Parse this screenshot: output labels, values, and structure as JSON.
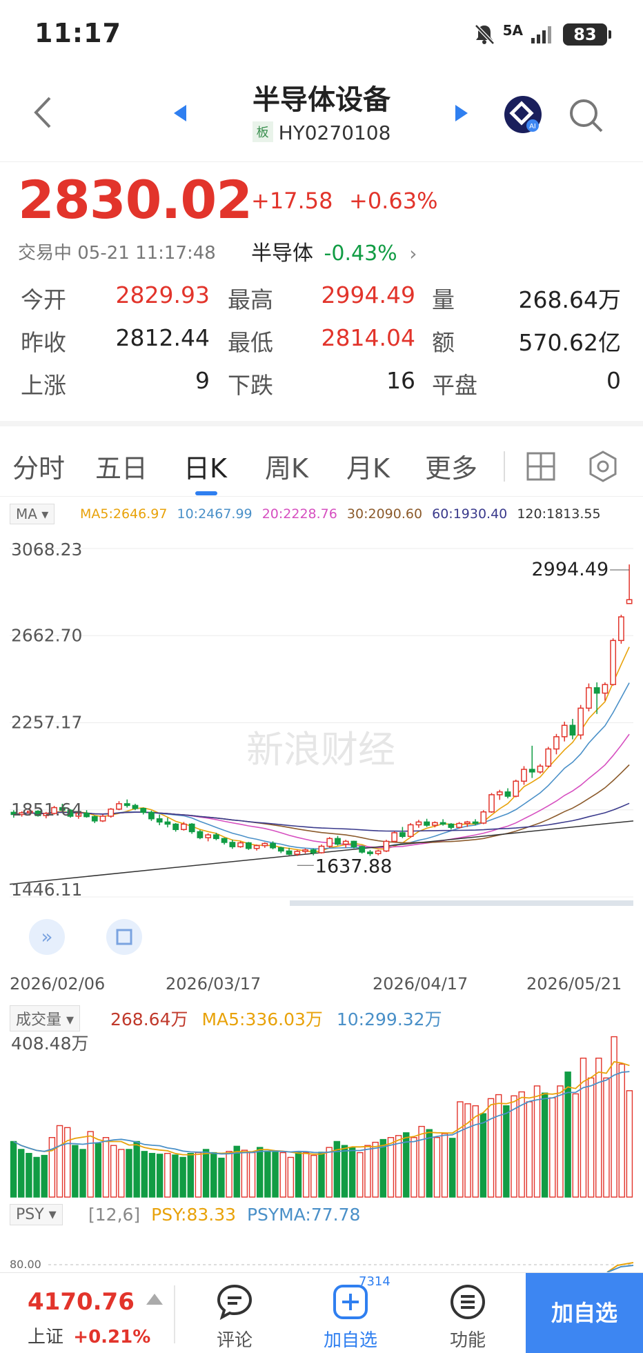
{
  "status_bar": {
    "time": "11:17",
    "network": "5A",
    "battery": "83"
  },
  "nav": {
    "title": "半导体设备",
    "tag": "板",
    "code": "HY0270108"
  },
  "quote": {
    "price": "2830.02",
    "change": "+17.58",
    "change_pct": "+0.63%",
    "trading_status": "交易中 05-21 11:17:48",
    "sector_label": "半导体",
    "sector_pct": "-0.43%"
  },
  "stats": {
    "open_label": "今开",
    "open": "2829.93",
    "high_label": "最高",
    "high": "2994.49",
    "volume_label": "量",
    "volume": "268.64万",
    "prev_close_label": "昨收",
    "prev_close": "2812.44",
    "low_label": "最低",
    "low": "2814.04",
    "amount_label": "额",
    "amount": "570.62亿",
    "up_label": "上涨",
    "up": "9",
    "down_label": "下跌",
    "down": "16",
    "flat_label": "平盘",
    "flat": "0"
  },
  "tabs": [
    "分时",
    "五日",
    "日K",
    "周K",
    "月K",
    "更多"
  ],
  "active_tab": "日K",
  "ma_legend": {
    "select": "MA ▾",
    "ma5": "MA5:2646.97",
    "ma10": "10:2467.99",
    "ma20": "20:2228.76",
    "ma30": "30:2090.60",
    "ma60": "60:1930.40",
    "ma120": "120:1813.55"
  },
  "colors": {
    "up": "#e2342b",
    "down": "#119c44",
    "ma5": "#e8a20a",
    "ma10": "#4a90c8",
    "ma20": "#d64fc0",
    "ma30": "#8b5a2b",
    "ma60": "#3a3a8c",
    "ma120": "#333333",
    "accent": "#2f7ff0"
  },
  "chart_data": [
    {
      "type": "candlestick",
      "title": "",
      "y_tick_labels": [
        "3068.23",
        "2662.70",
        "2257.17",
        "1851.64",
        "1446.11"
      ],
      "ylim": [
        1446.11,
        3068.23
      ],
      "x_tick_labels": [
        "2026/02/06",
        "2026/03/17",
        "2026/04/17",
        "2026/05/21"
      ],
      "annotations": [
        {
          "label": "2994.49",
          "value": 2994.49
        },
        {
          "label": "1637.88",
          "value": 1637.88
        }
      ],
      "watermark": "新浪财经",
      "series_note": "approx daily OHLC estimated from chart",
      "ohlc": [
        [
          1840,
          1850,
          1815,
          1830
        ],
        [
          1830,
          1845,
          1820,
          1838
        ],
        [
          1838,
          1860,
          1825,
          1845
        ],
        [
          1845,
          1850,
          1820,
          1825
        ],
        [
          1825,
          1842,
          1812,
          1835
        ],
        [
          1835,
          1870,
          1830,
          1862
        ],
        [
          1862,
          1880,
          1845,
          1850
        ],
        [
          1850,
          1855,
          1815,
          1822
        ],
        [
          1822,
          1840,
          1810,
          1836
        ],
        [
          1836,
          1850,
          1815,
          1820
        ],
        [
          1820,
          1825,
          1790,
          1800
        ],
        [
          1800,
          1830,
          1795,
          1822
        ],
        [
          1822,
          1860,
          1815,
          1855
        ],
        [
          1855,
          1892,
          1850,
          1880
        ],
        [
          1880,
          1900,
          1862,
          1872
        ],
        [
          1872,
          1880,
          1850,
          1858
        ],
        [
          1858,
          1862,
          1830,
          1840
        ],
        [
          1840,
          1848,
          1800,
          1810
        ],
        [
          1810,
          1830,
          1780,
          1795
        ],
        [
          1795,
          1815,
          1770,
          1785
        ],
        [
          1785,
          1790,
          1750,
          1760
        ],
        [
          1760,
          1795,
          1755,
          1785
        ],
        [
          1785,
          1790,
          1740,
          1750
        ],
        [
          1750,
          1758,
          1715,
          1722
        ],
        [
          1722,
          1742,
          1705,
          1735
        ],
        [
          1735,
          1745,
          1710,
          1718
        ],
        [
          1718,
          1722,
          1690,
          1700
        ],
        [
          1700,
          1712,
          1670,
          1680
        ],
        [
          1680,
          1705,
          1675,
          1698
        ],
        [
          1698,
          1702,
          1665,
          1672
        ],
        [
          1672,
          1690,
          1662,
          1685
        ],
        [
          1685,
          1700,
          1675,
          1695
        ],
        [
          1695,
          1705,
          1668,
          1675
        ],
        [
          1675,
          1680,
          1650,
          1660
        ],
        [
          1660,
          1675,
          1640,
          1645
        ],
        [
          1645,
          1665,
          1637,
          1658
        ],
        [
          1658,
          1672,
          1648,
          1665
        ],
        [
          1665,
          1672,
          1640,
          1652
        ],
        [
          1652,
          1690,
          1648,
          1682
        ],
        [
          1682,
          1725,
          1675,
          1718
        ],
        [
          1718,
          1730,
          1685,
          1692
        ],
        [
          1692,
          1712,
          1675,
          1705
        ],
        [
          1705,
          1708,
          1672,
          1680
        ],
        [
          1680,
          1685,
          1648,
          1655
        ],
        [
          1655,
          1665,
          1637,
          1648
        ],
        [
          1648,
          1665,
          1640,
          1660
        ],
        [
          1660,
          1712,
          1655,
          1705
        ],
        [
          1705,
          1752,
          1700,
          1745
        ],
        [
          1745,
          1772,
          1720,
          1728
        ],
        [
          1728,
          1790,
          1722,
          1782
        ],
        [
          1782,
          1805,
          1768,
          1795
        ],
        [
          1795,
          1810,
          1772,
          1780
        ],
        [
          1780,
          1798,
          1770,
          1792
        ],
        [
          1792,
          1808,
          1778,
          1785
        ],
        [
          1785,
          1790,
          1760,
          1770
        ],
        [
          1770,
          1795,
          1765,
          1788
        ],
        [
          1788,
          1800,
          1772,
          1795
        ],
        [
          1795,
          1808,
          1780,
          1790
        ],
        [
          1790,
          1850,
          1785,
          1842
        ],
        [
          1842,
          1930,
          1838,
          1922
        ],
        [
          1922,
          1945,
          1898,
          1935
        ],
        [
          1935,
          1952,
          1905,
          1915
        ],
        [
          1915,
          1992,
          1910,
          1985
        ],
        [
          1985,
          2055,
          1968,
          2040
        ],
        [
          2040,
          2150,
          2000,
          2028
        ],
        [
          2028,
          2065,
          2020,
          2055
        ],
        [
          2055,
          2145,
          2050,
          2135
        ],
        [
          2135,
          2205,
          2110,
          2192
        ],
        [
          2192,
          2262,
          2170,
          2245
        ],
        [
          2245,
          2275,
          2180,
          2200
        ],
        [
          2200,
          2340,
          2180,
          2325
        ],
        [
          2325,
          2440,
          2310,
          2420
        ],
        [
          2420,
          2445,
          2298,
          2395
        ],
        [
          2395,
          2445,
          2360,
          2435
        ],
        [
          2435,
          2650,
          2430,
          2640
        ],
        [
          2640,
          2760,
          2625,
          2750
        ],
        [
          2812,
          2994,
          2814,
          2830
        ]
      ]
    },
    {
      "type": "bar",
      "title": "成交量",
      "legend": [
        "268.64万",
        "MA5:336.03万",
        "10:299.32万"
      ],
      "y_tick_labels": [
        "408.48万"
      ],
      "ylim": [
        0,
        408.48
      ],
      "unit": "万",
      "values": [
        140,
        120,
        110,
        100,
        105,
        150,
        180,
        175,
        130,
        120,
        165,
        135,
        150,
        130,
        120,
        120,
        140,
        115,
        110,
        108,
        110,
        106,
        100,
        110,
        112,
        120,
        112,
        98,
        115,
        128,
        118,
        112,
        125,
        116,
        113,
        112,
        100,
        112,
        112,
        105,
        113,
        125,
        140,
        130,
        125,
        112,
        130,
        138,
        145,
        150,
        155,
        162,
        150,
        178,
        170,
        150,
        160,
        148,
        240,
        235,
        230,
        210,
        248,
        258,
        230,
        255,
        265,
        240,
        280,
        262,
        250,
        280,
        315,
        260,
        350,
        300,
        350,
        300,
        404,
        335,
        268
      ],
      "up_flags": [
        0,
        0,
        0,
        0,
        0,
        1,
        1,
        1,
        0,
        0,
        1,
        0,
        1,
        1,
        1,
        0,
        0,
        0,
        0,
        0,
        1,
        0,
        0,
        0,
        1,
        0,
        0,
        0,
        1,
        0,
        1,
        1,
        0,
        0,
        0,
        1,
        1,
        0,
        1,
        1,
        0,
        1,
        0,
        0,
        0,
        1,
        1,
        1,
        0,
        1,
        1,
        0,
        1,
        1,
        0,
        1,
        1,
        0,
        1,
        1,
        1,
        0,
        1,
        1,
        0,
        1,
        1,
        1,
        1,
        0,
        1,
        1,
        0,
        1,
        1,
        1,
        1,
        1,
        1,
        1,
        1
      ]
    },
    {
      "type": "line",
      "title": "PSY",
      "params": "[12,6]",
      "legend": [
        "PSY:83.33",
        "PSYMA:77.78"
      ],
      "y_tick_labels": [
        "80.00"
      ],
      "psy": 83.33,
      "psyma": 77.78
    }
  ],
  "bottom_bar": {
    "index_value": "4170.76",
    "index_name": "上证",
    "index_pct": "+0.21%",
    "comment_label": "评论",
    "add_label": "加自选",
    "add_count": "7314",
    "function_label": "功能",
    "primary_label": "加自选"
  }
}
